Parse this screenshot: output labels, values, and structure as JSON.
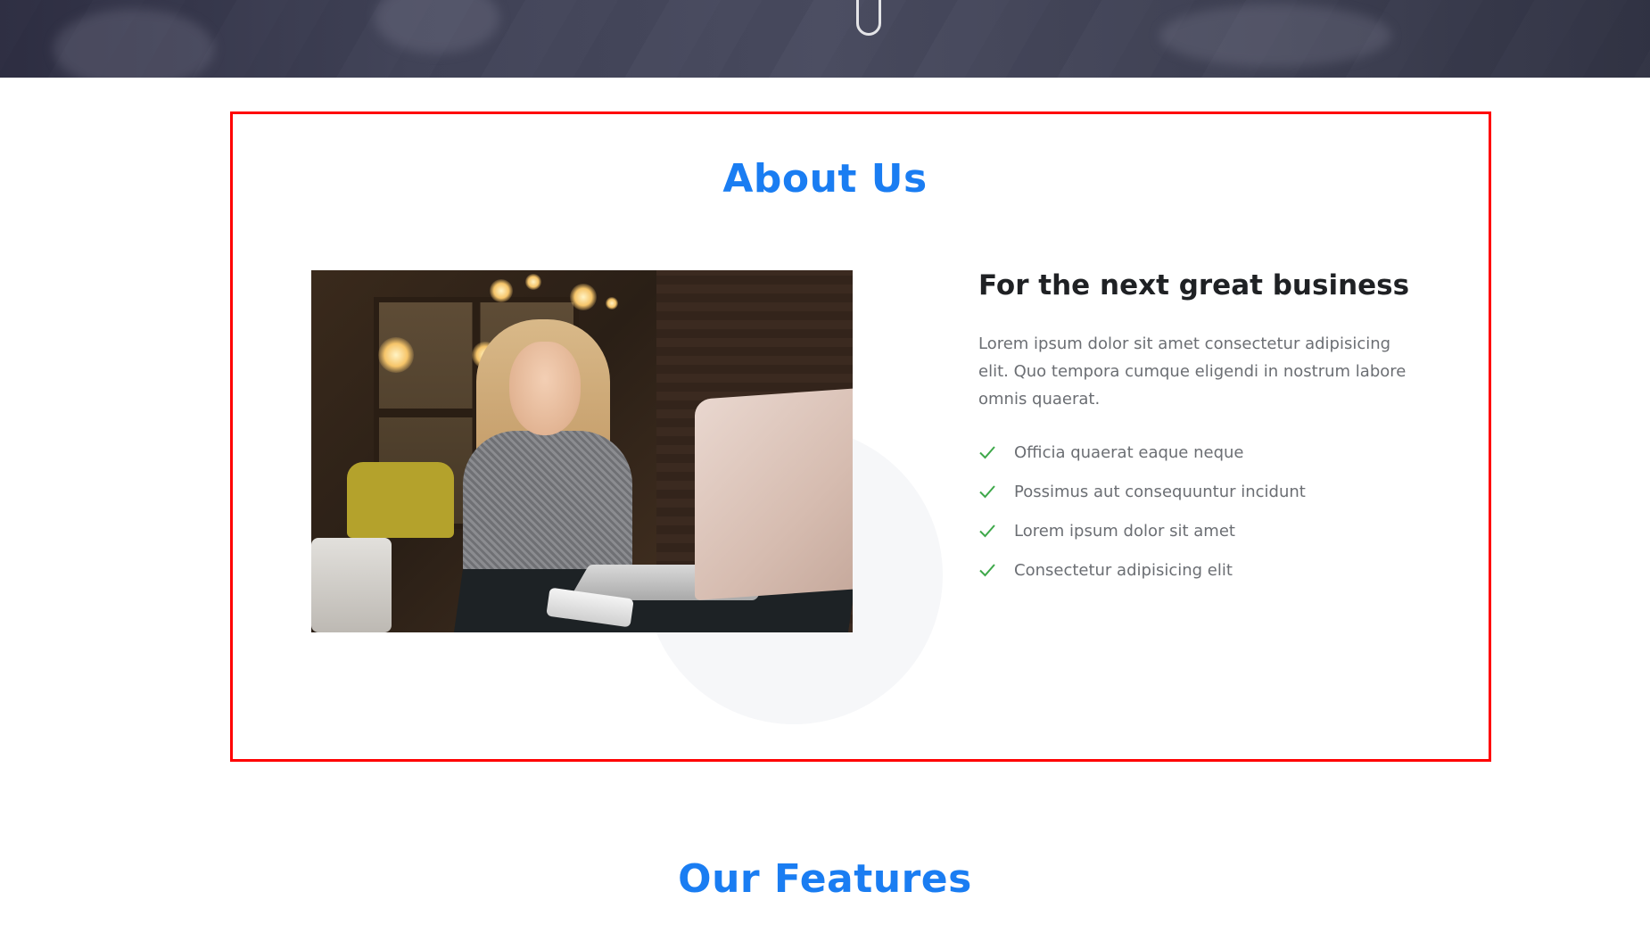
{
  "hero": {
    "scroll_indicator_icon": "mouse-scroll-icon"
  },
  "about": {
    "title": "About Us",
    "subtitle": "For the next great business",
    "paragraph": "Lorem ipsum dolor sit amet consectetur adipisicing elit. Quo tempora cumque eligendi in nostrum labore omnis quaerat.",
    "features": [
      {
        "icon": "check-icon",
        "label": "Officia quaerat eaque neque"
      },
      {
        "icon": "check-icon",
        "label": "Possimus aut consequuntur incidunt"
      },
      {
        "icon": "check-icon",
        "label": "Lorem ipsum dolor sit amet"
      },
      {
        "icon": "check-icon",
        "label": "Consectetur adipisicing elit"
      }
    ]
  },
  "features_section": {
    "title": "Our Features"
  },
  "colors": {
    "accent": "#1a7df2",
    "check": "#3ea84a",
    "highlight_frame": "#ff0000",
    "body_text": "#6b6e73",
    "heading_text": "#1f2124"
  }
}
